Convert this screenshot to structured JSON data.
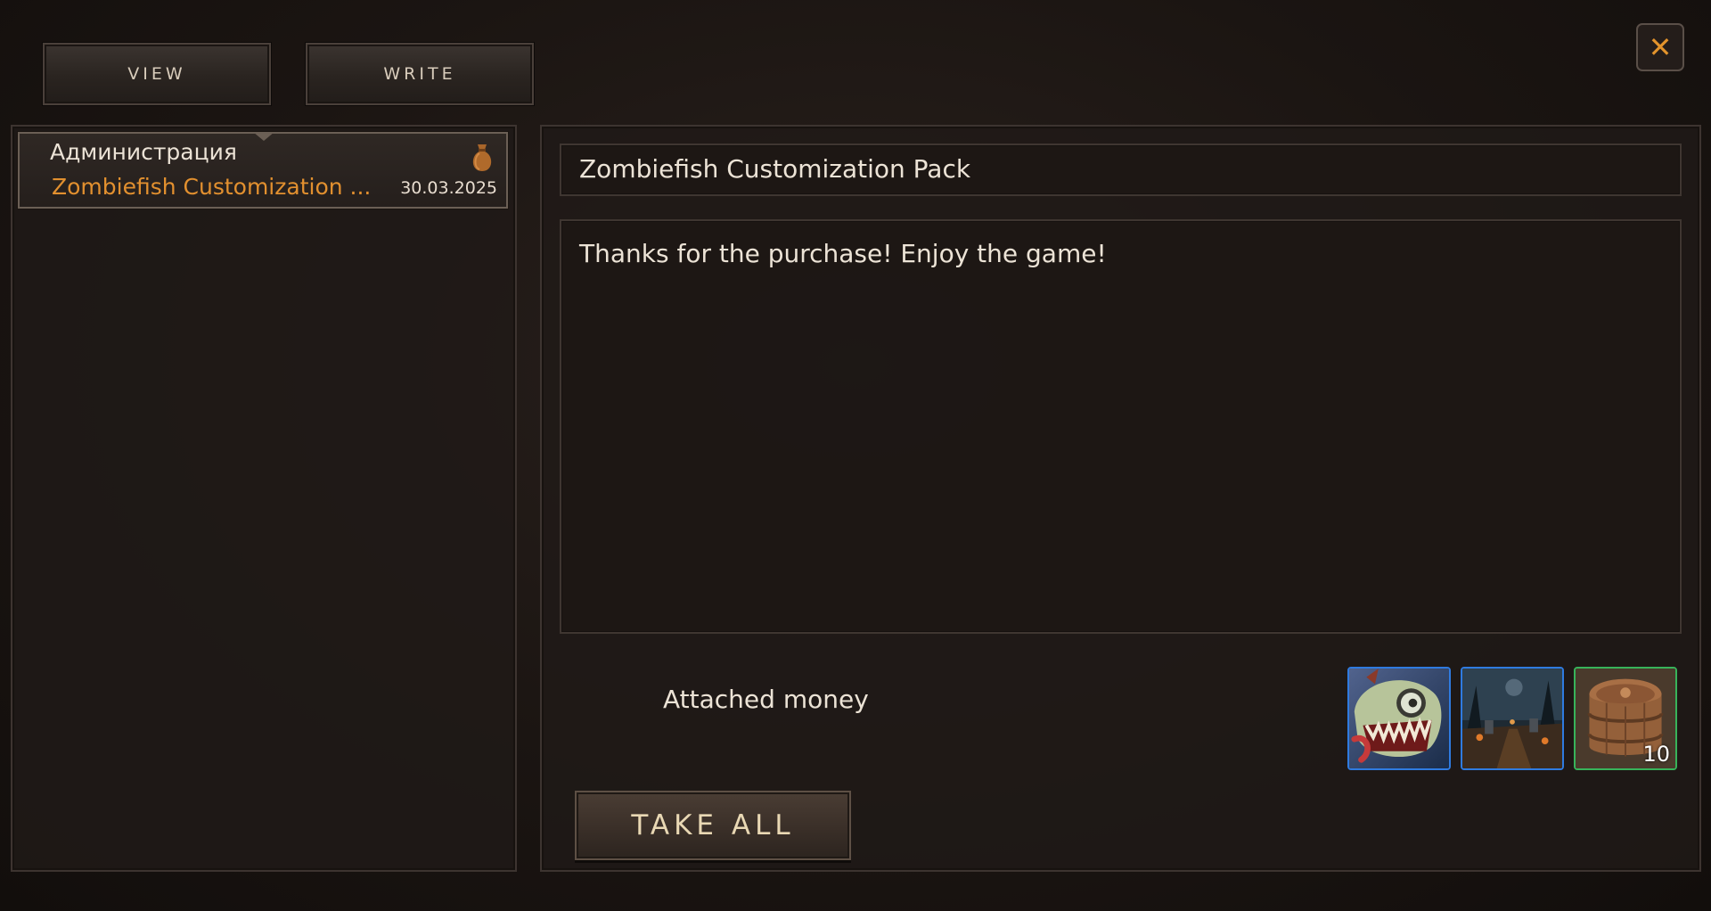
{
  "tabs": {
    "view_label": "VIEW",
    "write_label": "WRITE"
  },
  "close_icon": "close-icon",
  "mail_list": [
    {
      "sender": "Администрация",
      "subject": "Zombiefish Customization ...",
      "date": "30.03.2025",
      "icon": "money-bag-icon"
    }
  ],
  "message": {
    "subject": "Zombiefish Customization Pack",
    "body": "Thanks for the purchase! Enjoy the game!",
    "attached_label": "Attached money",
    "attachments": [
      {
        "icon": "zombie-fish-icon",
        "rarity_color": "#2f7be0"
      },
      {
        "icon": "graveyard-scene-icon",
        "rarity_color": "#2f7be0"
      },
      {
        "icon": "barrel-icon",
        "rarity_color": "#38b35a",
        "quantity": "10"
      }
    ],
    "take_all_label": "TAKE ALL"
  },
  "colors": {
    "accent": "#e2902f",
    "close": "#e2932c"
  }
}
